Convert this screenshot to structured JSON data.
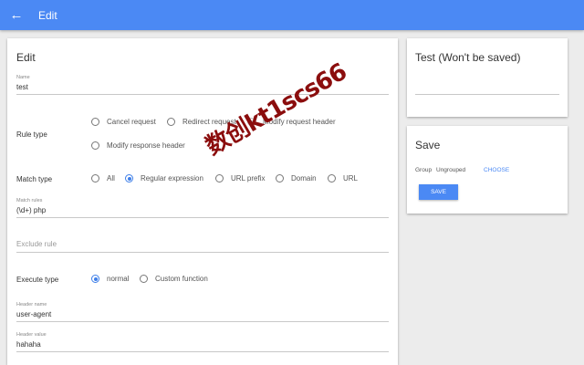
{
  "appbar": {
    "title": "Edit",
    "back_icon": "arrow-left-icon"
  },
  "editor": {
    "heading": "Edit",
    "name": {
      "label": "Name",
      "value": "test"
    },
    "rule_type": {
      "label": "Rule type",
      "options": [
        "Cancel request",
        "Redirect request",
        "Modify request header",
        "Modify response header"
      ],
      "selected": "Modify request header"
    },
    "match_type": {
      "label": "Match type",
      "options": [
        "All",
        "Regular expression",
        "URL prefix",
        "Domain",
        "URL"
      ],
      "selected": "Regular expression"
    },
    "match_rules": {
      "label": "Match rules",
      "value": "(\\d+) php"
    },
    "exclude_rule": {
      "placeholder": "Exclude rule"
    },
    "execute_type": {
      "label": "Execute type",
      "options": [
        "normal",
        "Custom function"
      ],
      "selected": "normal"
    },
    "header_name": {
      "label": "Header name",
      "value": "user-agent"
    },
    "header_value": {
      "label": "Header value",
      "value": "hahaha"
    }
  },
  "test_panel": {
    "heading": "Test (Won't be saved)",
    "input_value": ""
  },
  "save_panel": {
    "heading": "Save",
    "group_label": "Group",
    "group_value": "Ungrouped",
    "choose_label": "CHOOSE",
    "save_label": "SAVE"
  },
  "watermark": "数创kt1scs66",
  "colors": {
    "appbar": "#4b89f4",
    "accent": "#3d7ee8",
    "background": "#ececec",
    "watermark": "#8b0d0d"
  }
}
